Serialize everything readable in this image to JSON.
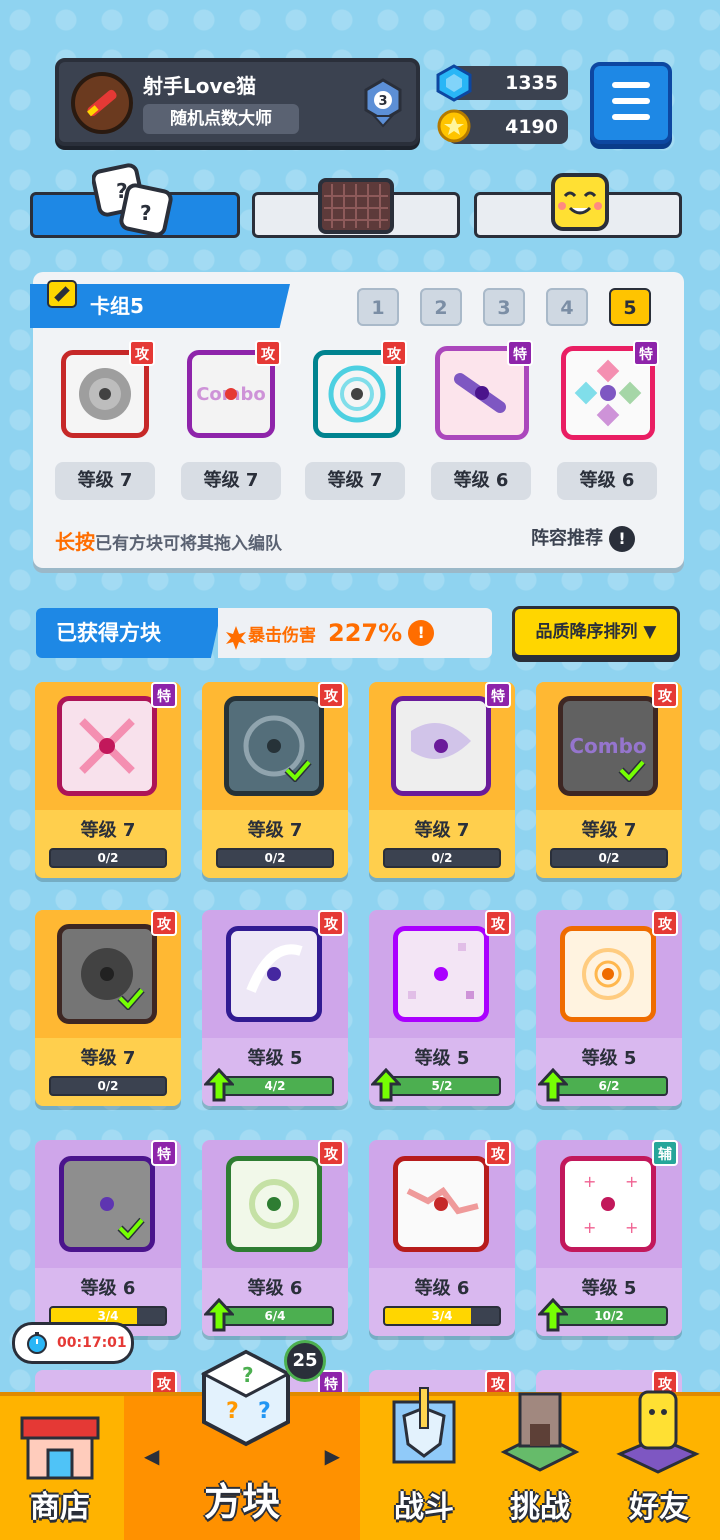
{
  "player": {
    "name": "射手Love猫",
    "title": "随机点数大师",
    "rank": "3"
  },
  "currency": {
    "gems": "1335",
    "coins": "4190"
  },
  "tabs": [
    {
      "name": "dice"
    },
    {
      "name": "board"
    },
    {
      "name": "emote"
    }
  ],
  "deck": {
    "title": "卡组5",
    "numbers": [
      "1",
      "2",
      "3",
      "4",
      "5"
    ],
    "selected": "5",
    "cards": [
      {
        "badge": "攻",
        "level": "等级 7",
        "icon": "spiral-dice-icon"
      },
      {
        "badge": "攻",
        "level": "等级 7",
        "icon": "combo-dice-icon"
      },
      {
        "badge": "攻",
        "level": "等级 7",
        "icon": "wind-dice-icon"
      },
      {
        "badge": "特",
        "level": "等级 6",
        "icon": "arrow-dice-icon"
      },
      {
        "badge": "特",
        "level": "等级 6",
        "icon": "rainbow-dice-icon"
      }
    ],
    "hint_prefix": "长按",
    "hint_text": "已有方块可将其拖入编队",
    "recommend": "阵容推荐",
    "recommend_icon": "!"
  },
  "acquired": {
    "title": "已获得方块",
    "crit_label": "暴击伤害",
    "crit_value": "227%",
    "crit_icon": "!",
    "sort_label": "品质降序排列 ▼"
  },
  "grid": [
    {
      "badge": "特",
      "level": "等级 7",
      "progress": "0/2",
      "style": "gold"
    },
    {
      "badge": "攻",
      "level": "等级 7",
      "progress": "0/2",
      "style": "gold"
    },
    {
      "badge": "特",
      "level": "等级 7",
      "progress": "0/2",
      "style": "gold"
    },
    {
      "badge": "攻",
      "level": "等级 7",
      "progress": "0/2",
      "style": "gold"
    },
    {
      "badge": "攻",
      "level": "等级 7",
      "progress": "0/2",
      "style": "gold"
    },
    {
      "badge": "攻",
      "level": "等级 5",
      "progress": "4/2",
      "style": "purp"
    },
    {
      "badge": "攻",
      "level": "等级 5",
      "progress": "5/2",
      "style": "purp"
    },
    {
      "badge": "攻",
      "level": "等级 5",
      "progress": "6/2",
      "style": "purp"
    },
    {
      "badge": "特",
      "level": "等级 6",
      "progress": "3/4",
      "style": "purp"
    },
    {
      "badge": "攻",
      "level": "等级 6",
      "progress": "6/4",
      "style": "purp"
    },
    {
      "badge": "攻",
      "level": "等级 6",
      "progress": "3/4",
      "style": "purp"
    },
    {
      "badge": "辅",
      "level": "等级 5",
      "progress": "10/2",
      "style": "purp"
    }
  ],
  "row4_badges": [
    "攻",
    "特",
    "攻",
    "攻"
  ],
  "timer": "00:17:01",
  "dice_count": "25",
  "nav": [
    {
      "label": "商店"
    },
    {
      "label": "方块"
    },
    {
      "label": "战斗"
    },
    {
      "label": "挑战"
    },
    {
      "label": "好友"
    }
  ],
  "nav_arrows": {
    "left": "◀",
    "right": "▶"
  },
  "colors": {
    "accent": "#1e88e5",
    "gold": "#ffb300",
    "attack": "#e53935",
    "special": "#8e24aa",
    "support": "#26a69a"
  }
}
